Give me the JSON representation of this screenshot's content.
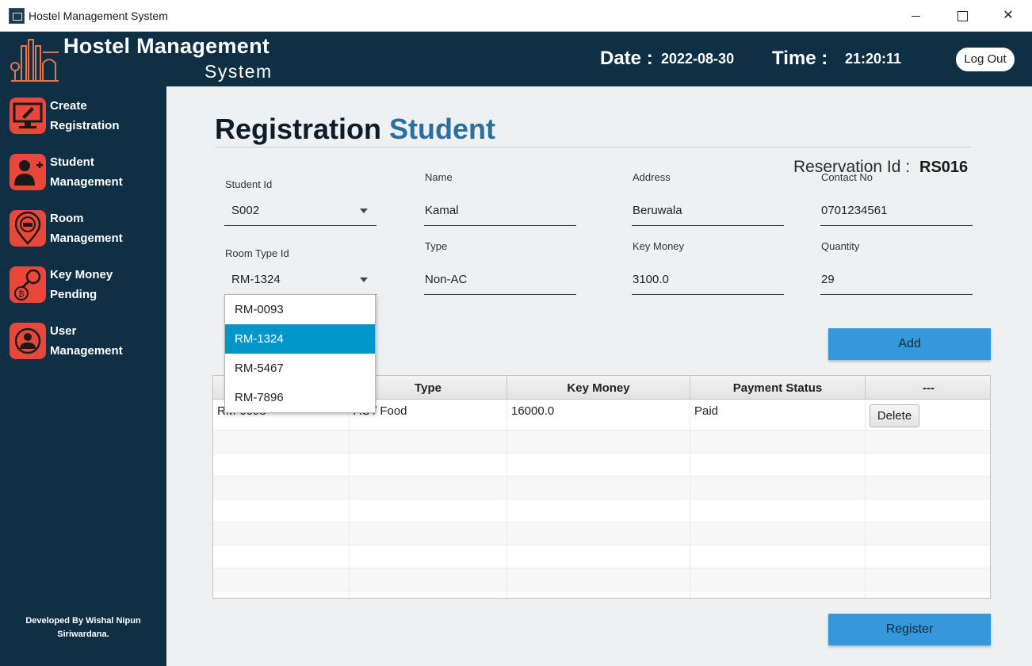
{
  "window": {
    "title": "Hostel Management System"
  },
  "header": {
    "brand_line1": "Hostel Management",
    "brand_line2": "System",
    "date_label": "Date :",
    "date_value": "2022-08-30",
    "time_label": "Time :",
    "time_value": "21:20:11",
    "logout_label": "Log Out"
  },
  "sidebar": {
    "items": [
      {
        "label": "Create\nRegistration",
        "icon": "registration-icon"
      },
      {
        "label": "Student\nManagement",
        "icon": "add-user-icon"
      },
      {
        "label": "Room\nManagement",
        "icon": "room-location-icon"
      },
      {
        "label": "Key Money\nPending",
        "icon": "key-coin-icon"
      },
      {
        "label": "User\nManagement",
        "icon": "user-icon"
      }
    ],
    "credit": "Developed By Wishal Nipun\nSiriwardana."
  },
  "page": {
    "title_main": "Registration",
    "title_accent": "Student",
    "reservation_label": "Reservation Id :",
    "reservation_value": "RS016"
  },
  "form": {
    "student_id": {
      "label": "Student Id",
      "value": "S002"
    },
    "name": {
      "label": "Name",
      "value": "Kamal"
    },
    "address": {
      "label": "Address",
      "value": "Beruwala"
    },
    "contact": {
      "label": "Contact No",
      "value": "0701234561"
    },
    "room_type_id": {
      "label": "Room Type Id",
      "value": "RM-1324"
    },
    "type": {
      "label": "Type",
      "value": "Non-AC"
    },
    "key_money": {
      "label": "Key Money",
      "value": "3100.0"
    },
    "quantity": {
      "label": "Quantity",
      "value": "29"
    }
  },
  "buttons": {
    "add": "Add",
    "register": "Register",
    "delete": "Delete"
  },
  "table": {
    "columns": [
      "",
      "Type",
      "Key Money",
      "Payment Status",
      "---"
    ],
    "rows": [
      {
        "room": "RM-0093",
        "type": "AC / Food",
        "key_money": "16000.0",
        "status": "Paid"
      }
    ]
  },
  "dropdown": {
    "options": [
      "RM-0093",
      "RM-1324",
      "RM-5467",
      "RM-7896"
    ],
    "selected": "RM-1324"
  },
  "colors": {
    "navy": "#0e2f44",
    "accent_red": "#e9473a",
    "button_blue": "#3498db",
    "selection_blue": "#0096c9",
    "title_accent": "#2a6f9e"
  }
}
